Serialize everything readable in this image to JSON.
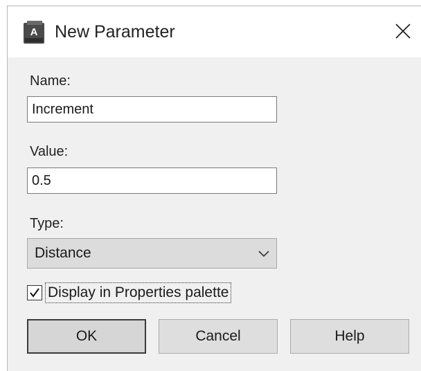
{
  "window": {
    "title": "New Parameter",
    "app_icon": "autocad-app-icon",
    "app_icon_letter": "A",
    "close_icon": "close-icon"
  },
  "form": {
    "name": {
      "label": "Name:",
      "value": "Increment"
    },
    "value": {
      "label": "Value:",
      "value": "0.5"
    },
    "type": {
      "label": "Type:",
      "selected": "Distance",
      "icon": "chevron-down-icon"
    },
    "display_checkbox": {
      "label": "Display in Properties palette",
      "checked": true
    }
  },
  "buttons": {
    "ok": "OK",
    "cancel": "Cancel",
    "help": "Help"
  },
  "colors": {
    "dialog_bg": "#f0f0f0",
    "titlebar_bg": "#ffffff",
    "button_bg": "#dedede",
    "select_bg": "#dcdcdc"
  }
}
